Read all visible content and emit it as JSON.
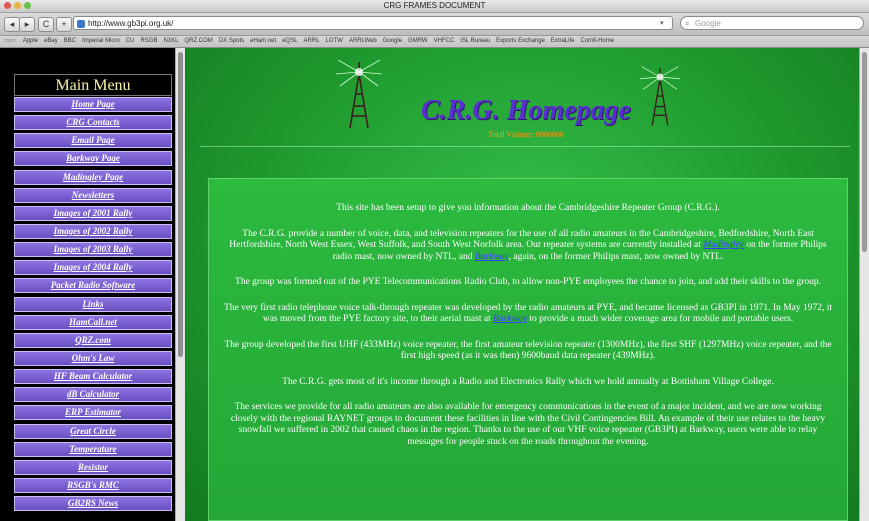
{
  "window": {
    "title": "CRG FRAMES DOCUMENT"
  },
  "toolbar": {
    "back_label": "◂",
    "forward_label": "▸",
    "reload_label": "C",
    "add_label": "+",
    "url": "http://www.gb3pi.org.uk/",
    "search_placeholder": "Google"
  },
  "bookmarks": [
    "Apple",
    "eBay",
    "BBC",
    "Imperial Micro",
    "CU",
    "RSGB",
    "N1KL",
    "QRZ.COM",
    "DX Spots",
    "eHam.net",
    "eQSL",
    "ARRL",
    "LOTW",
    "ARRLWeb",
    "Google",
    "GMRW",
    "VHFCC",
    "ISL Bureau",
    "Exports Exchange",
    "ExtraLife",
    "Comfi-Home"
  ],
  "left": {
    "menu_title": "Main Menu",
    "items": [
      "Home Page",
      "CRG Contacts",
      "Email Page",
      "Barkway Page",
      "Madingley Page",
      "Newsletters",
      "Images of 2001 Rally",
      "Images of 2002 Rally",
      "Images of 2003 Rally",
      "Images of 2004 Rally",
      "Packet Radio Software",
      "Links",
      "HamCall.net",
      "QRZ.com",
      "Ohm's Law",
      "HF Beam Calculator",
      "dB Calculator",
      "ERP Estimator",
      "Great Circle",
      "Temperature",
      "Resistor",
      "RSGB's RMC",
      "GB2RS News"
    ]
  },
  "main": {
    "title": "C.R.G. Homepage",
    "visits": "Total Visitors: 0000000",
    "p1": "This site has been setup to give you information about the Cambridgeshire Repeater Group (C.R.G.).",
    "p2a": "The C.R.G. provide a number of voice, data, and television repeaters for the use of all radio amateurs in the Cambridgeshire, Bedfordshire, North East Hertfordshire, North West Essex, West Suffolk, and South West Norfolk area. Our repeater systems are currently installed at",
    "p2_link1": "Madingley",
    "p2b": "on the former Philips radio mast, now owned by NTL, and",
    "p2_link2": "Barkway",
    "p2c": ", again, on the former Philips mast, now owned by NTL.",
    "p3": "The group was formed out of the PYE Telecommunications Radio Club, to allow non-PYE employees the chance to join, and add their skills to the group.",
    "p4a": "The very first radio telephone voice talk-through repeater was developed by the radio amateurs at PYE, and became licensed as GB3PI in 1971. In May 1972, it was moved from the PYE factory site, to their aerial mast at",
    "p4_link": "Barkway",
    "p4b": "to provide a much wider coverage area for mobile and portable users.",
    "p5": "The group developed the first UHF (433MHz) voice repeater, the first amateur television repeater (1300MHz), the first SHF (1297MHz) voice repeater, and the first high speed (as it was then) 9600baud data repeater (439MHz).",
    "p6": "The C.R.G. gets most of it's income through a Radio and Electronics Rally which we hold annually at Bottisham Village College.",
    "p7": "The services we provide for all radio amateurs are also available for emergency communications in the event of a major incident, and we are now working closely with the regional RAYNET groups to document these facilities in line with the Civil Contingencies Bill. An example of their use relates to the heavy snowfall we suffered in 2002 that caused chaos in the region. Thanks to the use of our VHF voice repeater (GB3PI) at Barkway, users were able to relay messages for people stuck on the roads throughout the evening."
  },
  "colors": {
    "page_green": "#24a737",
    "menu_purple": "#6a4fc2",
    "title_purple": "#5a2fd2",
    "menu_title_yellow": "#f7f3a9"
  }
}
